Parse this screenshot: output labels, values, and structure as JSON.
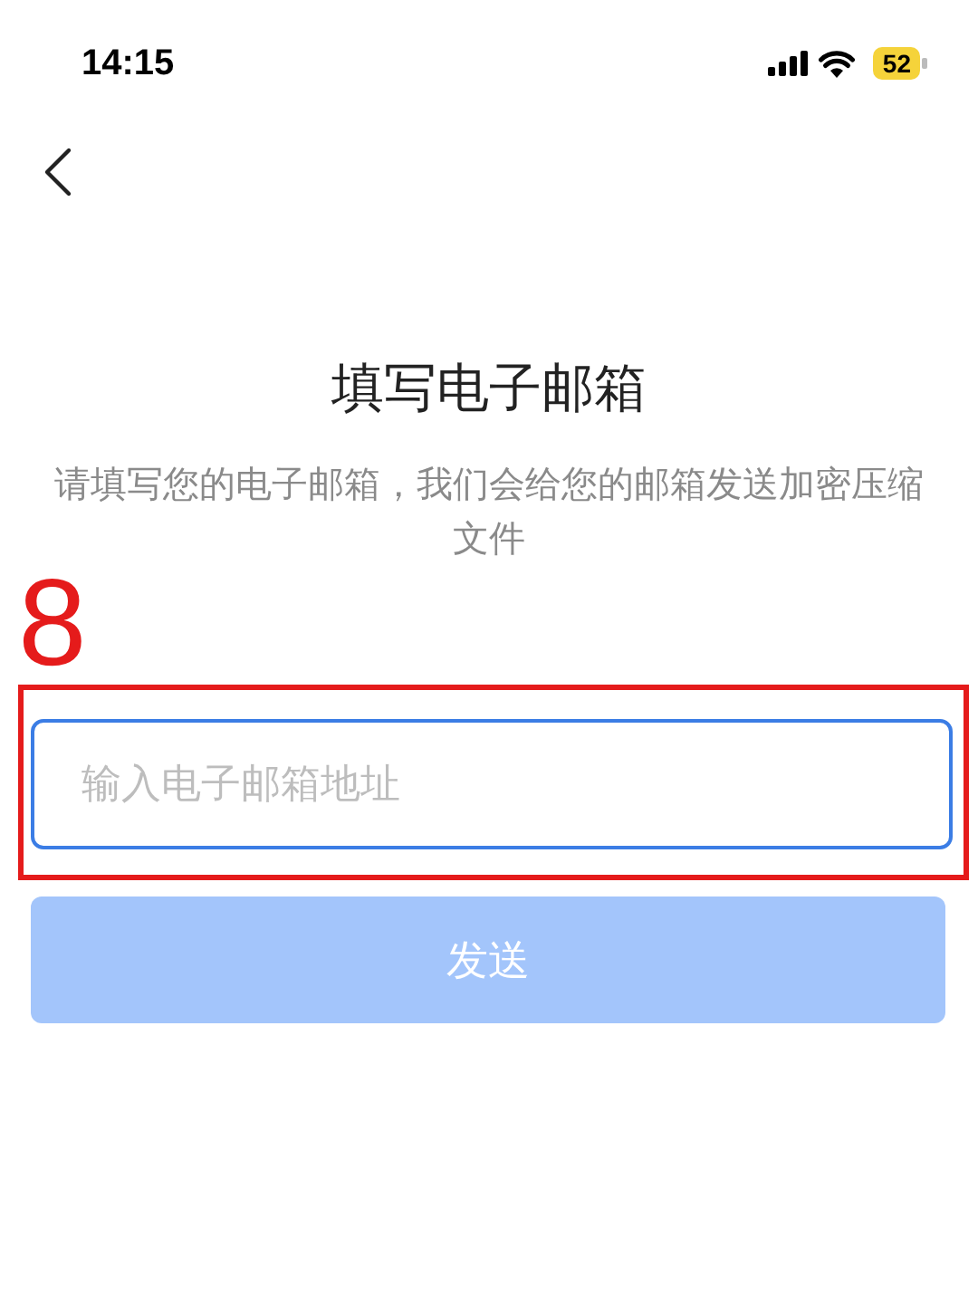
{
  "status_bar": {
    "time": "14:15",
    "battery": "52"
  },
  "title": "填写电子邮箱",
  "subtitle": "请填写您的电子邮箱，我们会给您的邮箱发送加密压缩文件",
  "annotation": {
    "step": "8"
  },
  "email_field": {
    "placeholder": "输入电子邮箱地址"
  },
  "send_button": {
    "label": "发送",
    "disabled": true
  }
}
